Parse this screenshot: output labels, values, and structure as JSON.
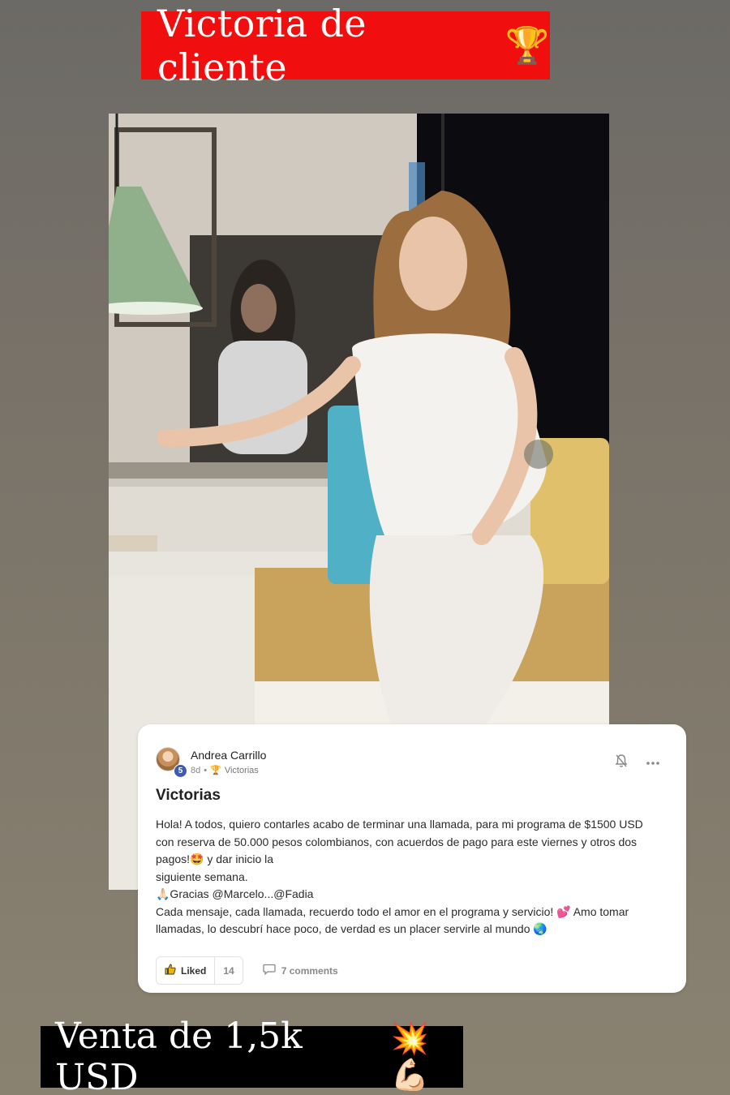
{
  "top_banner": {
    "text": "Victoria de cliente",
    "emoji": "🏆"
  },
  "post": {
    "author": {
      "name": "Andrea Carrillo",
      "level": "5",
      "age": "8d",
      "category_icon": "🏆",
      "category": "Victorias"
    },
    "title": "Victorias",
    "body": [
      "Hola! A todos, quiero contarles acabo de terminar una llamada, para mi programa de $1500 USD con reserva de 50.000 pesos colombianos, con acuerdos de pago para este viernes y otros dos pagos!🤩 y dar inicio la",
      "siguiente semana.",
      "🙏🏻Gracias @Marcelo...@Fadia",
      "Cada mensaje, cada llamada, recuerdo todo el amor en el programa y servicio! 💕 Amo tomar llamadas, lo descubrí hace poco, de verdad es un placer servirle al mundo 🌏"
    ],
    "like_label": "Liked",
    "like_count": "14",
    "comments_label": "7 comments",
    "icons": {
      "bell": "bell-off-icon",
      "more": "more-options-icon",
      "like": "thumbs-up-icon",
      "comment": "comment-icon"
    }
  },
  "bottom_banner": {
    "text": "Venta de 1,5k USD",
    "emoji": "💥💪🏻"
  }
}
